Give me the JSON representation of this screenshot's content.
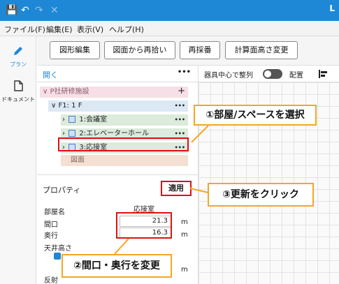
{
  "titlebar": {
    "save_icon": "save-icon",
    "undo_icon": "undo-icon",
    "redo_icon": "redo-icon",
    "close_icon": "close-icon",
    "right_text": "L"
  },
  "menu": {
    "file": "ファイル(F)",
    "edit": "編集(E)",
    "view": "表示(V)",
    "help": "ヘルプ(H)"
  },
  "nav": {
    "plan": "プラン",
    "document": "ドキュメント"
  },
  "toolbar": {
    "edit_shape": "図形編集",
    "reimport": "図面から再拾い",
    "renumber": "再採番",
    "calc_height": "計算面高さ変更"
  },
  "panel": {
    "title": "開く",
    "more": "•••"
  },
  "tree": {
    "root": "P社研修施設",
    "floor": "F1: 1 F",
    "rooms": [
      {
        "label": "1:会議室"
      },
      {
        "label": "2:エレベーターホール"
      },
      {
        "label": "3:応接室"
      }
    ],
    "drawing": "図面"
  },
  "right_toolbar": {
    "align_label": "器具中心で整列",
    "place_label": "配置"
  },
  "properties": {
    "title": "プロパティ",
    "apply": "適用",
    "room_name_label": "部屋名",
    "room_name": "応接室",
    "width_label": "間口",
    "width_value": "21.3",
    "depth_label": "奥行",
    "depth_value": "16.3",
    "unit": "m",
    "ceiling_label": "天井高さ",
    "reflect_label": "反射"
  },
  "callouts": {
    "select_room": "①部屋/スペースを選択",
    "click_update": "③更新をクリック",
    "change_dims": "②間口・奥行を変更"
  },
  "colors": {
    "accent": "#1e88d6",
    "callout_border": "#f5a623",
    "highlight": "#e01010"
  }
}
